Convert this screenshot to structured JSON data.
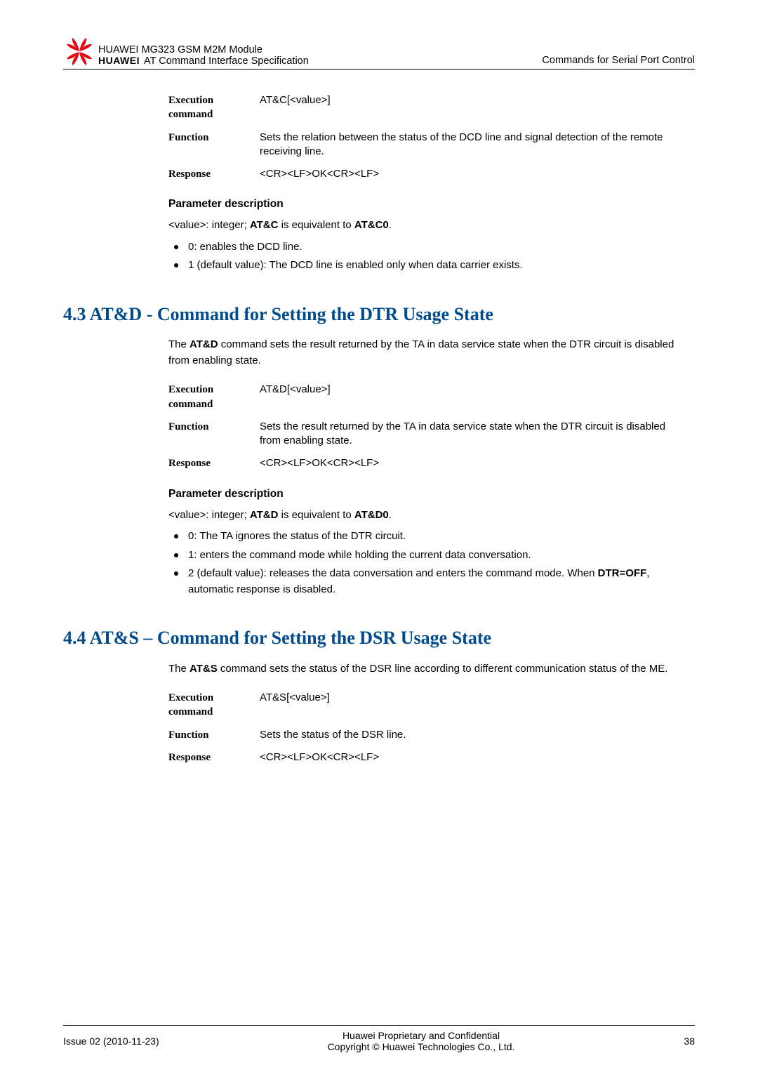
{
  "header": {
    "brand_name": "HUAWEI",
    "title_line1": "HUAWEI MG323 GSM M2M Module",
    "title_line2": "AT Command Interface Specification",
    "right": "Commands for Serial Port Control"
  },
  "block1": {
    "rows": [
      {
        "label": "Execution command",
        "value": "AT&C[<value>]"
      },
      {
        "label": "Function",
        "value": "Sets the relation between the status of the DCD line and signal detection of the remote receiving line."
      },
      {
        "label": "Response",
        "value": "<CR><LF>OK<CR><LF>"
      }
    ],
    "param_heading": "Parameter description",
    "param_intro_pre": "<value>: integer; ",
    "param_intro_b1": "AT&C",
    "param_intro_mid": " is equivalent to ",
    "param_intro_b2": "AT&C0",
    "param_intro_post": ".",
    "bullets": [
      "0: enables the DCD line.",
      "1 (default value): The DCD line is enabled only when data carrier exists."
    ]
  },
  "section43": {
    "heading": "4.3 AT&D - Command for Setting the DTR Usage State",
    "intro_pre": "The ",
    "intro_b": "AT&D",
    "intro_post": " command sets the result returned by the TA in data service state when the DTR circuit is disabled from enabling state.",
    "rows": [
      {
        "label": "Execution command",
        "value": "AT&D[<value>]"
      },
      {
        "label": "Function",
        "value": "Sets the result returned by the TA in data service state when the DTR circuit is disabled from enabling state."
      },
      {
        "label": "Response",
        "value": "<CR><LF>OK<CR><LF>"
      }
    ],
    "param_heading": "Parameter description",
    "param_intro_pre": "<value>: integer; ",
    "param_intro_b1": "AT&D",
    "param_intro_mid": " is equivalent to ",
    "param_intro_b2": "AT&D0",
    "param_intro_post": ".",
    "bullets_plain": [
      "0: The TA ignores the status of the DTR circuit.",
      "1: enters the command mode while holding the current data conversation."
    ],
    "bullet3_pre": "2 (default value): releases the data conversation and enters the command mode. When ",
    "bullet3_b": "DTR=OFF",
    "bullet3_post": ", automatic response is disabled."
  },
  "section44": {
    "heading": "4.4 AT&S – Command for Setting the DSR Usage State",
    "intro_pre": "The ",
    "intro_b": "AT&S",
    "intro_post": " command sets the status of the DSR line according to different communication status of the ME.",
    "rows": [
      {
        "label": "Execution command",
        "value": "AT&S[<value>]"
      },
      {
        "label": "Function",
        "value": "Sets the status of the DSR line."
      },
      {
        "label": "Response",
        "value": "<CR><LF>OK<CR><LF>"
      }
    ]
  },
  "footer": {
    "left": "Issue 02 (2010-11-23)",
    "center1": "Huawei Proprietary and Confidential",
    "center2": "Copyright © Huawei Technologies Co., Ltd.",
    "right": "38"
  }
}
